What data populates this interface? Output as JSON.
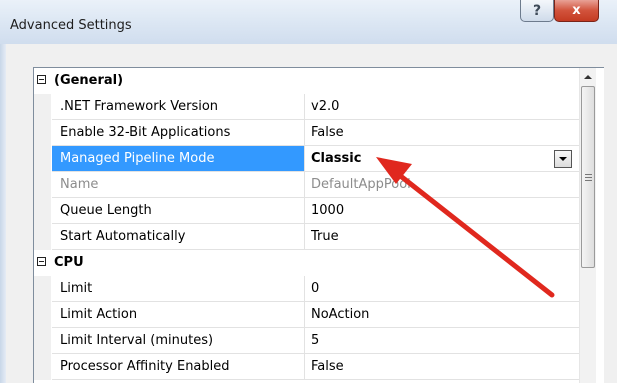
{
  "window": {
    "title": "Advanced Settings",
    "help_label": "?",
    "close_label": "x"
  },
  "categories": {
    "general": "(General)",
    "cpu": "CPU"
  },
  "properties": [
    {
      "name": ".NET Framework Version",
      "value": "v2.0"
    },
    {
      "name": "Enable 32-Bit Applications",
      "value": "False"
    },
    {
      "name": "Managed Pipeline Mode",
      "value": "Classic"
    },
    {
      "name": "Name",
      "value": "DefaultAppPool"
    },
    {
      "name": "Queue Length",
      "value": "1000"
    },
    {
      "name": "Start Automatically",
      "value": "True"
    },
    {
      "name": "Limit",
      "value": "0"
    },
    {
      "name": "Limit Action",
      "value": "NoAction"
    },
    {
      "name": "Limit Interval (minutes)",
      "value": "5"
    },
    {
      "name": "Processor Affinity Enabled",
      "value": "False"
    }
  ],
  "colors": {
    "selection": "#3399ff",
    "annotation_arrow": "#e0281e",
    "disabled_text": "#8c8c8c"
  },
  "icons": {
    "collapse": "minus-box-icon",
    "dropdown": "chevron-down-icon",
    "scroll_up": "arrow-up-icon",
    "annotation": "red-arrow-icon"
  }
}
